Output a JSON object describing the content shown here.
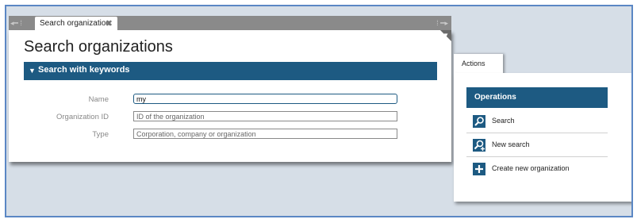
{
  "tab": {
    "label": "Search organization",
    "close": "✖"
  },
  "main": {
    "title": "Search organizations",
    "section_title": "Search with keywords",
    "fields": [
      {
        "label": "Name",
        "value": "my",
        "placeholder": ""
      },
      {
        "label": "Organization ID",
        "value": "",
        "placeholder": "ID of the organization"
      },
      {
        "label": "Type",
        "value": "",
        "placeholder": "Corporation, company or organization"
      }
    ]
  },
  "actions": {
    "tab_label": "Actions",
    "header": "Operations",
    "items": [
      {
        "label": "Search",
        "icon": "search-icon"
      },
      {
        "label": "New search",
        "icon": "new-search-icon"
      },
      {
        "label": "Create new organization",
        "icon": "plus-icon"
      }
    ]
  },
  "colors": {
    "accent": "#1d5a82",
    "frame": "#5b87c4",
    "background": "#d6dee7"
  }
}
